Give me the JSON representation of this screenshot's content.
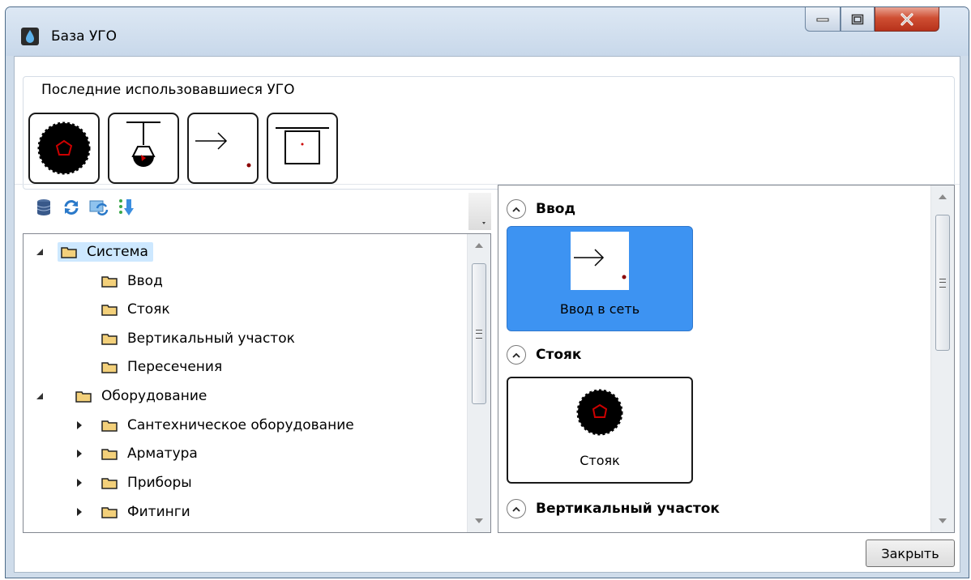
{
  "window": {
    "title": "База УГО"
  },
  "recent": {
    "legend": "Последние использовавшиеся УГО"
  },
  "tree": {
    "items": [
      {
        "label": "Система"
      },
      {
        "label": "Ввод"
      },
      {
        "label": "Стояк"
      },
      {
        "label": "Вертикальный участок"
      },
      {
        "label": "Пересечения"
      },
      {
        "label": "Оборудование"
      },
      {
        "label": "Сантехническое оборудование"
      },
      {
        "label": "Арматура"
      },
      {
        "label": "Приборы"
      },
      {
        "label": "Фитинги"
      }
    ]
  },
  "symbols": {
    "groups": [
      {
        "header": "Ввод",
        "card_label": "Ввод в сеть"
      },
      {
        "header": "Стояк",
        "card_label": "Стояк"
      },
      {
        "header": "Вертикальный участок"
      }
    ]
  },
  "footer": {
    "close_label": "Закрыть"
  },
  "colors": {
    "selection": "#3d93f2",
    "tree_selection": "#cde8ff",
    "close_button": "#cf4f33"
  }
}
